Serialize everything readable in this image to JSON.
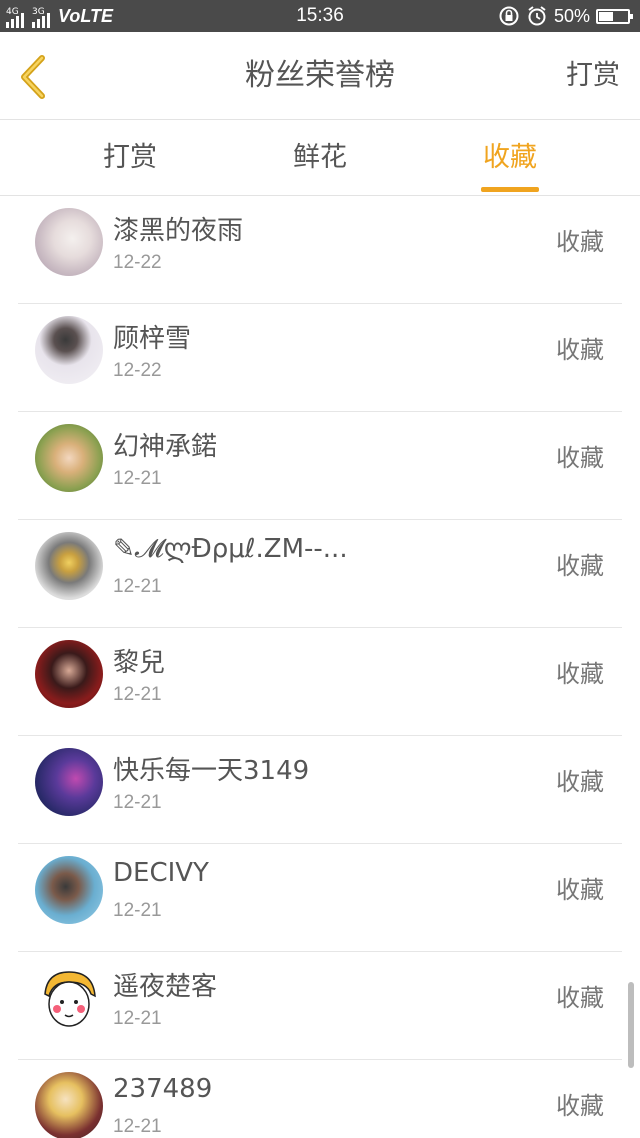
{
  "status_bar": {
    "network_1": "4G",
    "network_2": "3G",
    "carrier_mode": "VoLTE",
    "time": "15:36",
    "battery": "50%"
  },
  "header": {
    "title": "粉丝荣誉榜",
    "action_label": "打赏"
  },
  "tabs": [
    {
      "label": "打赏",
      "active": false
    },
    {
      "label": "鲜花",
      "active": false
    },
    {
      "label": "收藏",
      "active": true
    }
  ],
  "colors": {
    "accent": "#f0a41f",
    "status_bar_bg": "#4a4a4a"
  },
  "list": [
    {
      "name": "漆黑的夜雨",
      "date": "12-22",
      "action": "收藏"
    },
    {
      "name": "顾梓雪",
      "date": "12-22",
      "action": "收藏"
    },
    {
      "name": "幻神承鍩",
      "date": "12-21",
      "action": "收藏"
    },
    {
      "name": "✎𝓜ლĐρμℓ.ZM--...",
      "date": "12-21",
      "action": "收藏"
    },
    {
      "name": "黎兒",
      "date": "12-21",
      "action": "收藏"
    },
    {
      "name": "快乐每一天3149",
      "date": "12-21",
      "action": "收藏"
    },
    {
      "name": "DECIVY",
      "date": "12-21",
      "action": "收藏"
    },
    {
      "name": "遥夜楚客",
      "date": "12-21",
      "action": "收藏"
    },
    {
      "name": "237489",
      "date": "12-21",
      "action": "收藏"
    }
  ]
}
